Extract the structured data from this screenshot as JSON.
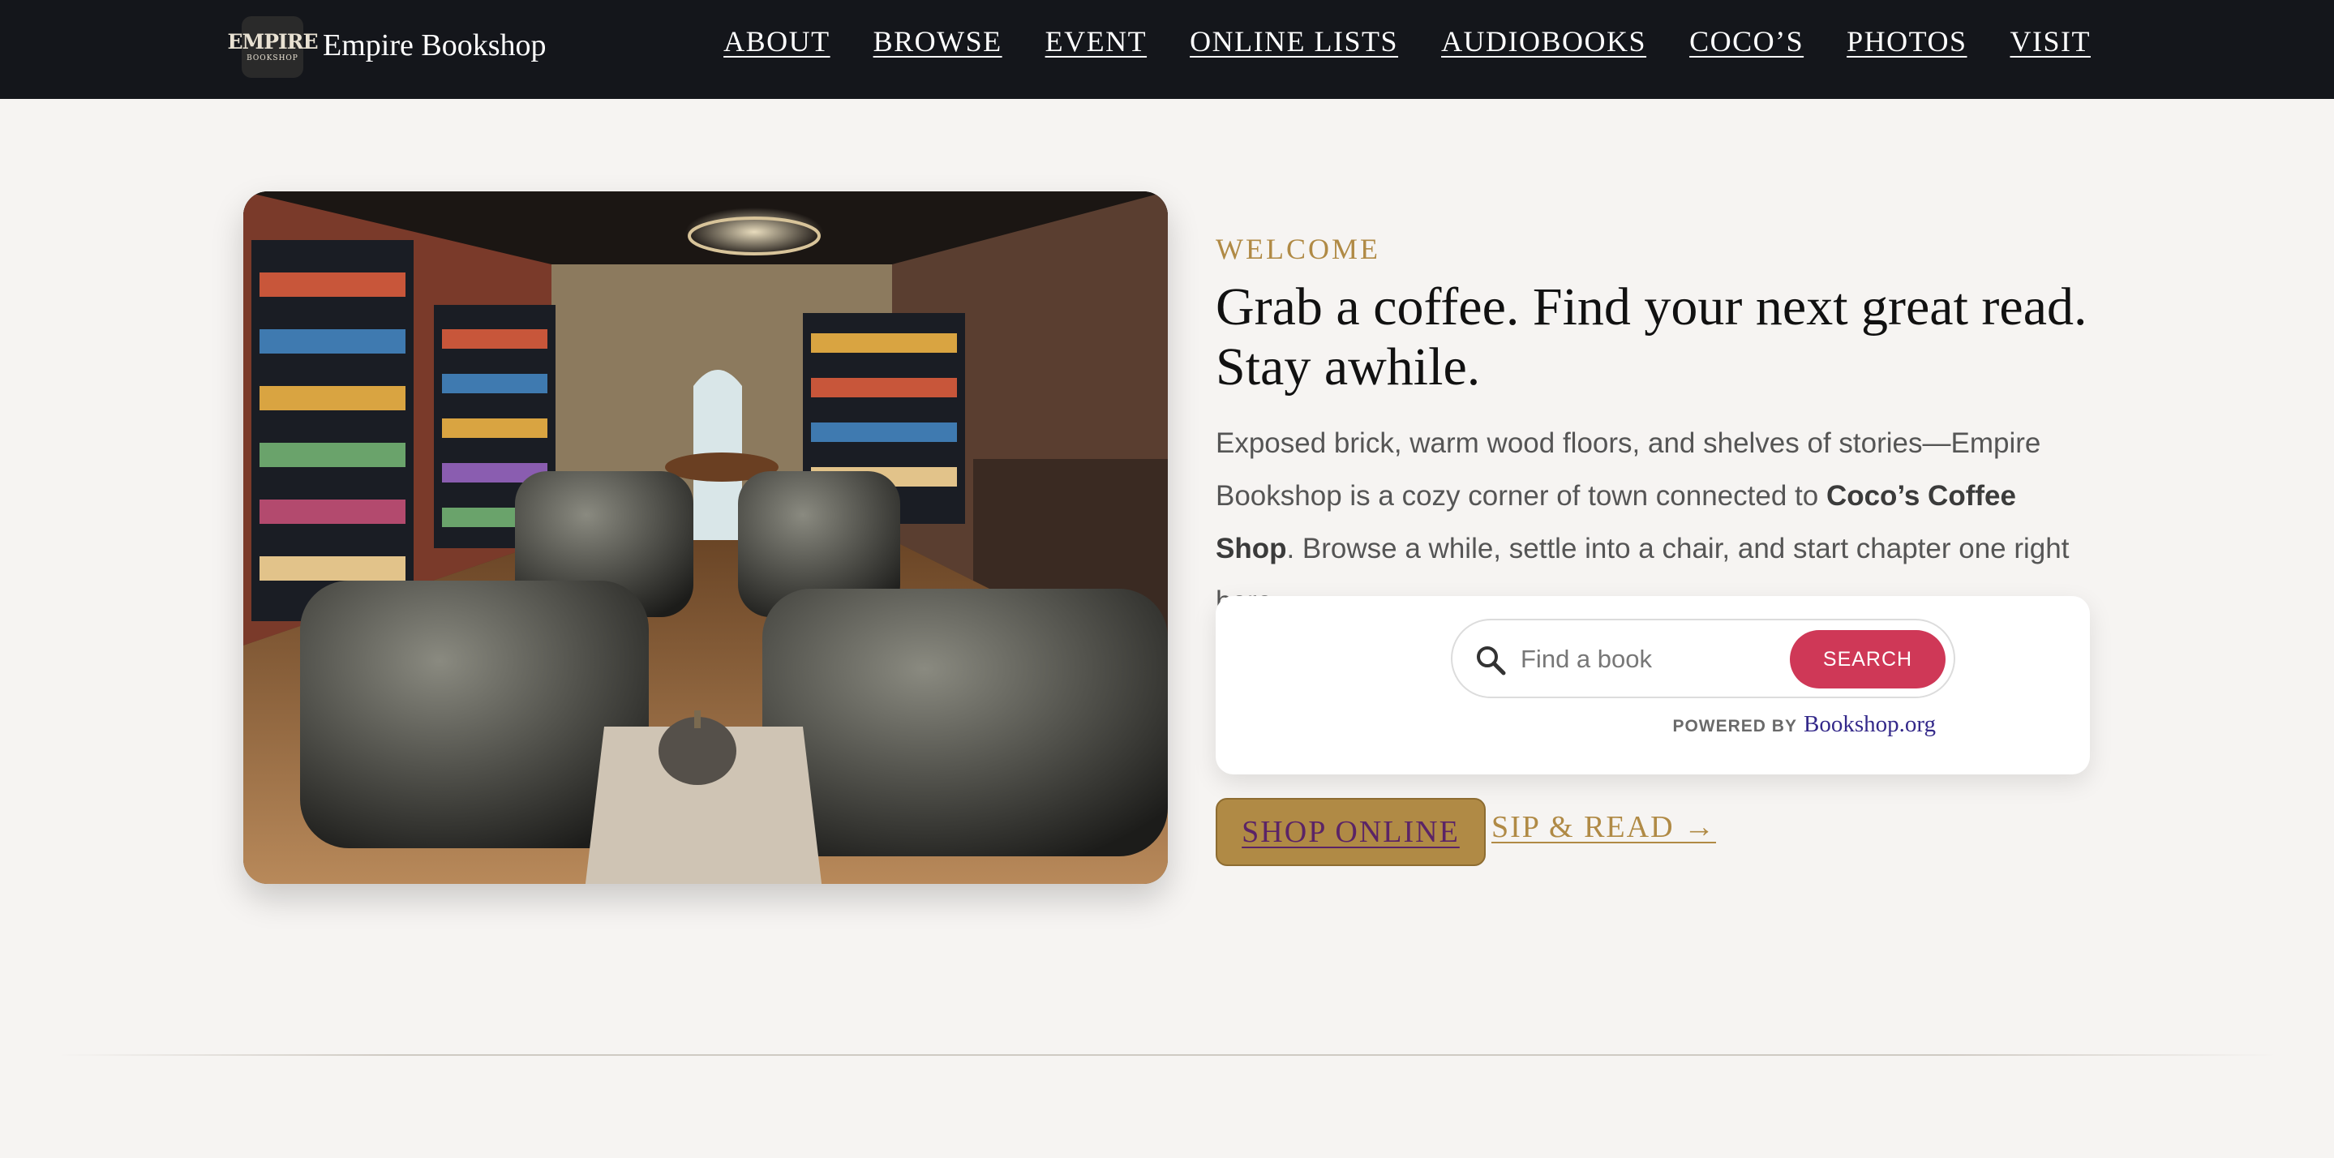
{
  "header": {
    "logo": {
      "big": "EMPIRE",
      "small": "BOOKSHOP"
    },
    "brand_name": "Empire Bookshop",
    "nav": [
      "ABOUT",
      "BROWSE",
      "EVENT",
      "ONLINE LISTS",
      "AUDIOBOOKS",
      "COCO’S",
      "PHOTOS",
      "VISIT"
    ]
  },
  "hero": {
    "eyebrow": "WELCOME",
    "headline": "Grab a coffee. Find your next great read. Stay awhile.",
    "lead_before": "Exposed brick, warm wood floors, and shelves of stories—Empire Bookshop is a cozy corner of town connected to ",
    "lead_bold": "Coco’s Coffee Shop",
    "lead_after": ". Browse a while, settle into a chair, and start chapter one right here."
  },
  "search": {
    "placeholder": "Find a book",
    "button_label": "SEARCH",
    "powered_by": "POWERED BY",
    "provider": "Bookshop.org"
  },
  "cta": {
    "shop_online": "SHOP ONLINE",
    "sip_read": "SIP & READ →"
  }
}
